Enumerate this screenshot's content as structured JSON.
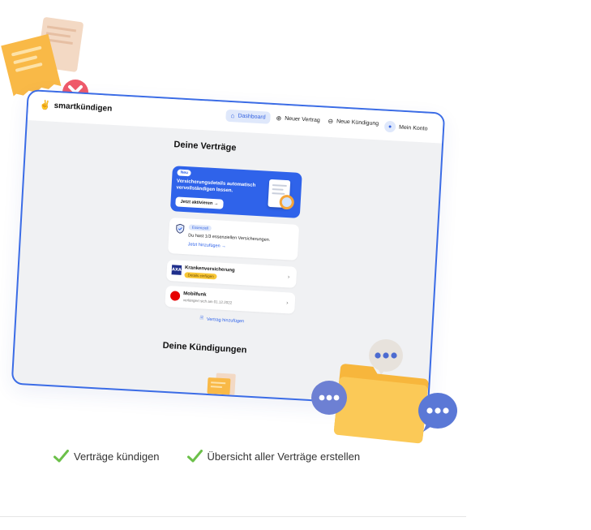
{
  "app": {
    "brand": "smartkündigen",
    "nav": [
      {
        "label": "Dashboard",
        "icon": "home-icon",
        "active": true
      },
      {
        "label": "Neuer Vertrag",
        "icon": "plus-circle-icon",
        "active": false
      },
      {
        "label": "Neue Kündigung",
        "icon": "minus-circle-icon",
        "active": false
      },
      {
        "label": "Mein Konto",
        "icon": "user-icon",
        "active": false
      }
    ]
  },
  "contracts": {
    "title": "Deine Verträge",
    "promo": {
      "badge": "Neu",
      "text": "Versicherungsdetails automatisch vervollständigen lassen.",
      "button": "Jetzt aktivieren →"
    },
    "essentials": {
      "badge": "Essenziell",
      "text": "Du hast 1/3 essenziellen Versicherungen.",
      "link": "Jetzt hinzufügen →"
    },
    "items": [
      {
        "title": "Krankenversicherung",
        "badge": "Details einfügen",
        "logo": "AXA",
        "logo_color": "#1f2f8c"
      },
      {
        "title": "Mobilfunk",
        "subtitle": "verlängert sich am 01.12.2022",
        "logo": "",
        "logo_color": "#e60000"
      }
    ],
    "add_label": "Vertrag hinzufügen"
  },
  "cancellations": {
    "title": "Deine Kündigungen"
  },
  "features": [
    {
      "label": "Verträge kündigen",
      "icon": "check-icon"
    },
    {
      "label": "Übersicht aller Verträge erstellen",
      "icon": "check-icon"
    }
  ],
  "colors": {
    "accent": "#2f63ea",
    "border": "#3b6ce6",
    "check": "#6cc04a",
    "warning": "#f8c737",
    "folder": "#f7b63c",
    "bubble": "#5a78d6"
  }
}
